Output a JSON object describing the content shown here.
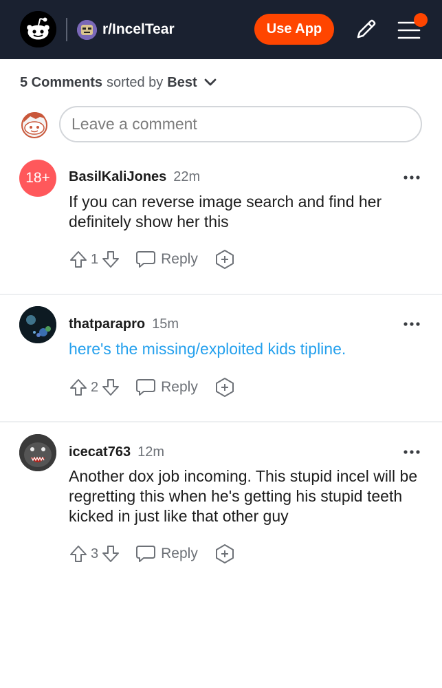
{
  "header": {
    "logo_icon": "reddit-snoo-icon",
    "subreddit": "r/IncelTear",
    "use_app_label": "Use App",
    "edit_icon": "pencil-icon",
    "menu_icon": "hamburger-menu-icon",
    "notification_dot_color": "#ff4500"
  },
  "sort": {
    "count_label": "5 Comments",
    "sorted_by_label": "sorted by",
    "sort_value": "Best"
  },
  "compose": {
    "placeholder": "Leave a comment"
  },
  "comments": [
    {
      "avatar_label": "18+",
      "author": "BasilKaliJones",
      "time": "22m",
      "body": "If you can reverse image search and find her definitely show her this",
      "score": "1",
      "reply_label": "Reply"
    },
    {
      "author": "thatparapro",
      "time": "15m",
      "body": "here's the missing/exploited kids tipline.",
      "score": "2",
      "reply_label": "Reply"
    },
    {
      "author": "icecat763",
      "time": "12m",
      "body": "Another dox job incoming. This stupid incel will be regretting this when he's getting his stupid teeth kicked in just like that other guy",
      "score": "3",
      "reply_label": "Reply"
    }
  ],
  "colors": {
    "header_bg": "#1a2130",
    "accent": "#ff4500",
    "link": "#24a0ed",
    "nsfw": "#ff585b"
  }
}
